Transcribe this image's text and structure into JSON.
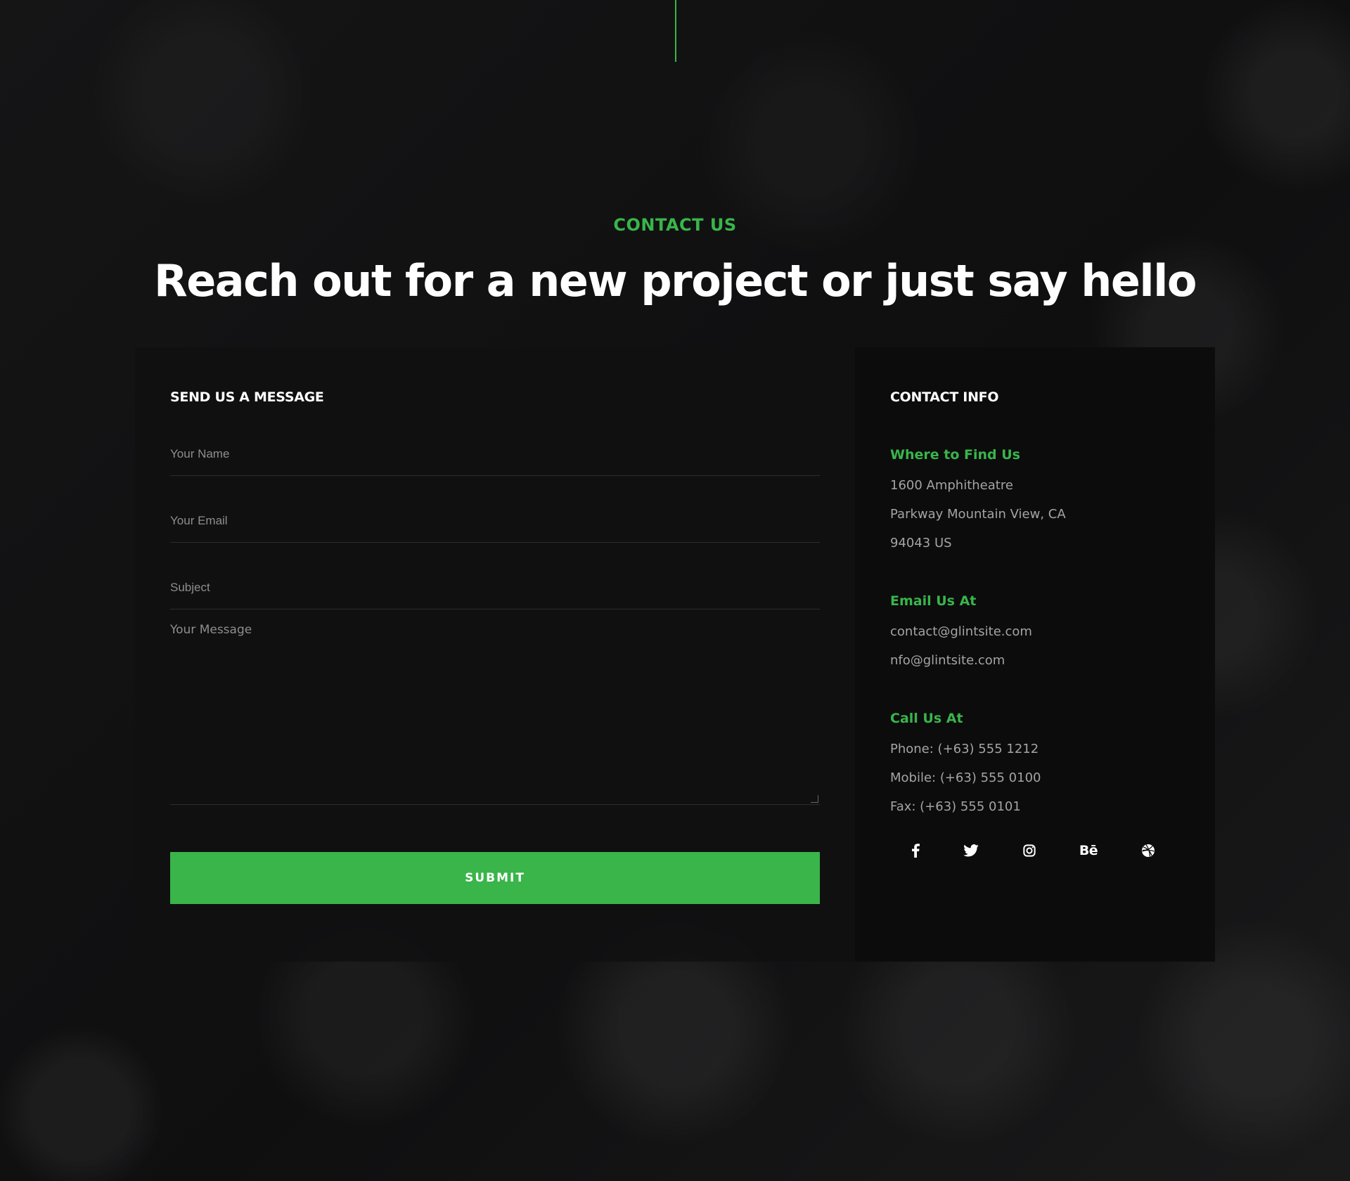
{
  "section": {
    "eyebrow": "CONTACT US",
    "headline": "Reach out for a new project or just say hello"
  },
  "form": {
    "title": "SEND US A MESSAGE",
    "name_placeholder": "Your Name",
    "email_placeholder": "Your Email",
    "subject_placeholder": "Subject",
    "message_placeholder": "Your Message",
    "submit_label": "SUBMIT"
  },
  "info": {
    "title": "CONTACT INFO",
    "find": {
      "heading": "Where to Find Us",
      "lines": [
        "1600 Amphitheatre",
        "Parkway Mountain View, CA",
        "94043 US"
      ]
    },
    "email": {
      "heading": "Email Us At",
      "lines": [
        "contact@glintsite.com",
        "nfo@glintsite.com"
      ]
    },
    "call": {
      "heading": "Call Us At",
      "lines": [
        "Phone: (+63) 555 1212",
        "Mobile: (+63) 555 0100",
        "Fax: (+63) 555 0101"
      ]
    },
    "social": [
      {
        "icon": "facebook-icon"
      },
      {
        "icon": "twitter-icon"
      },
      {
        "icon": "instagram-icon"
      },
      {
        "icon": "behance-icon",
        "glyph": "Bē"
      },
      {
        "icon": "dribbble-icon"
      }
    ]
  },
  "colors": {
    "accent": "#39b54a",
    "background": "#111112",
    "form_panel": "#101011",
    "info_panel": "#0c0c0d",
    "muted_text": "#a4a4a4"
  }
}
